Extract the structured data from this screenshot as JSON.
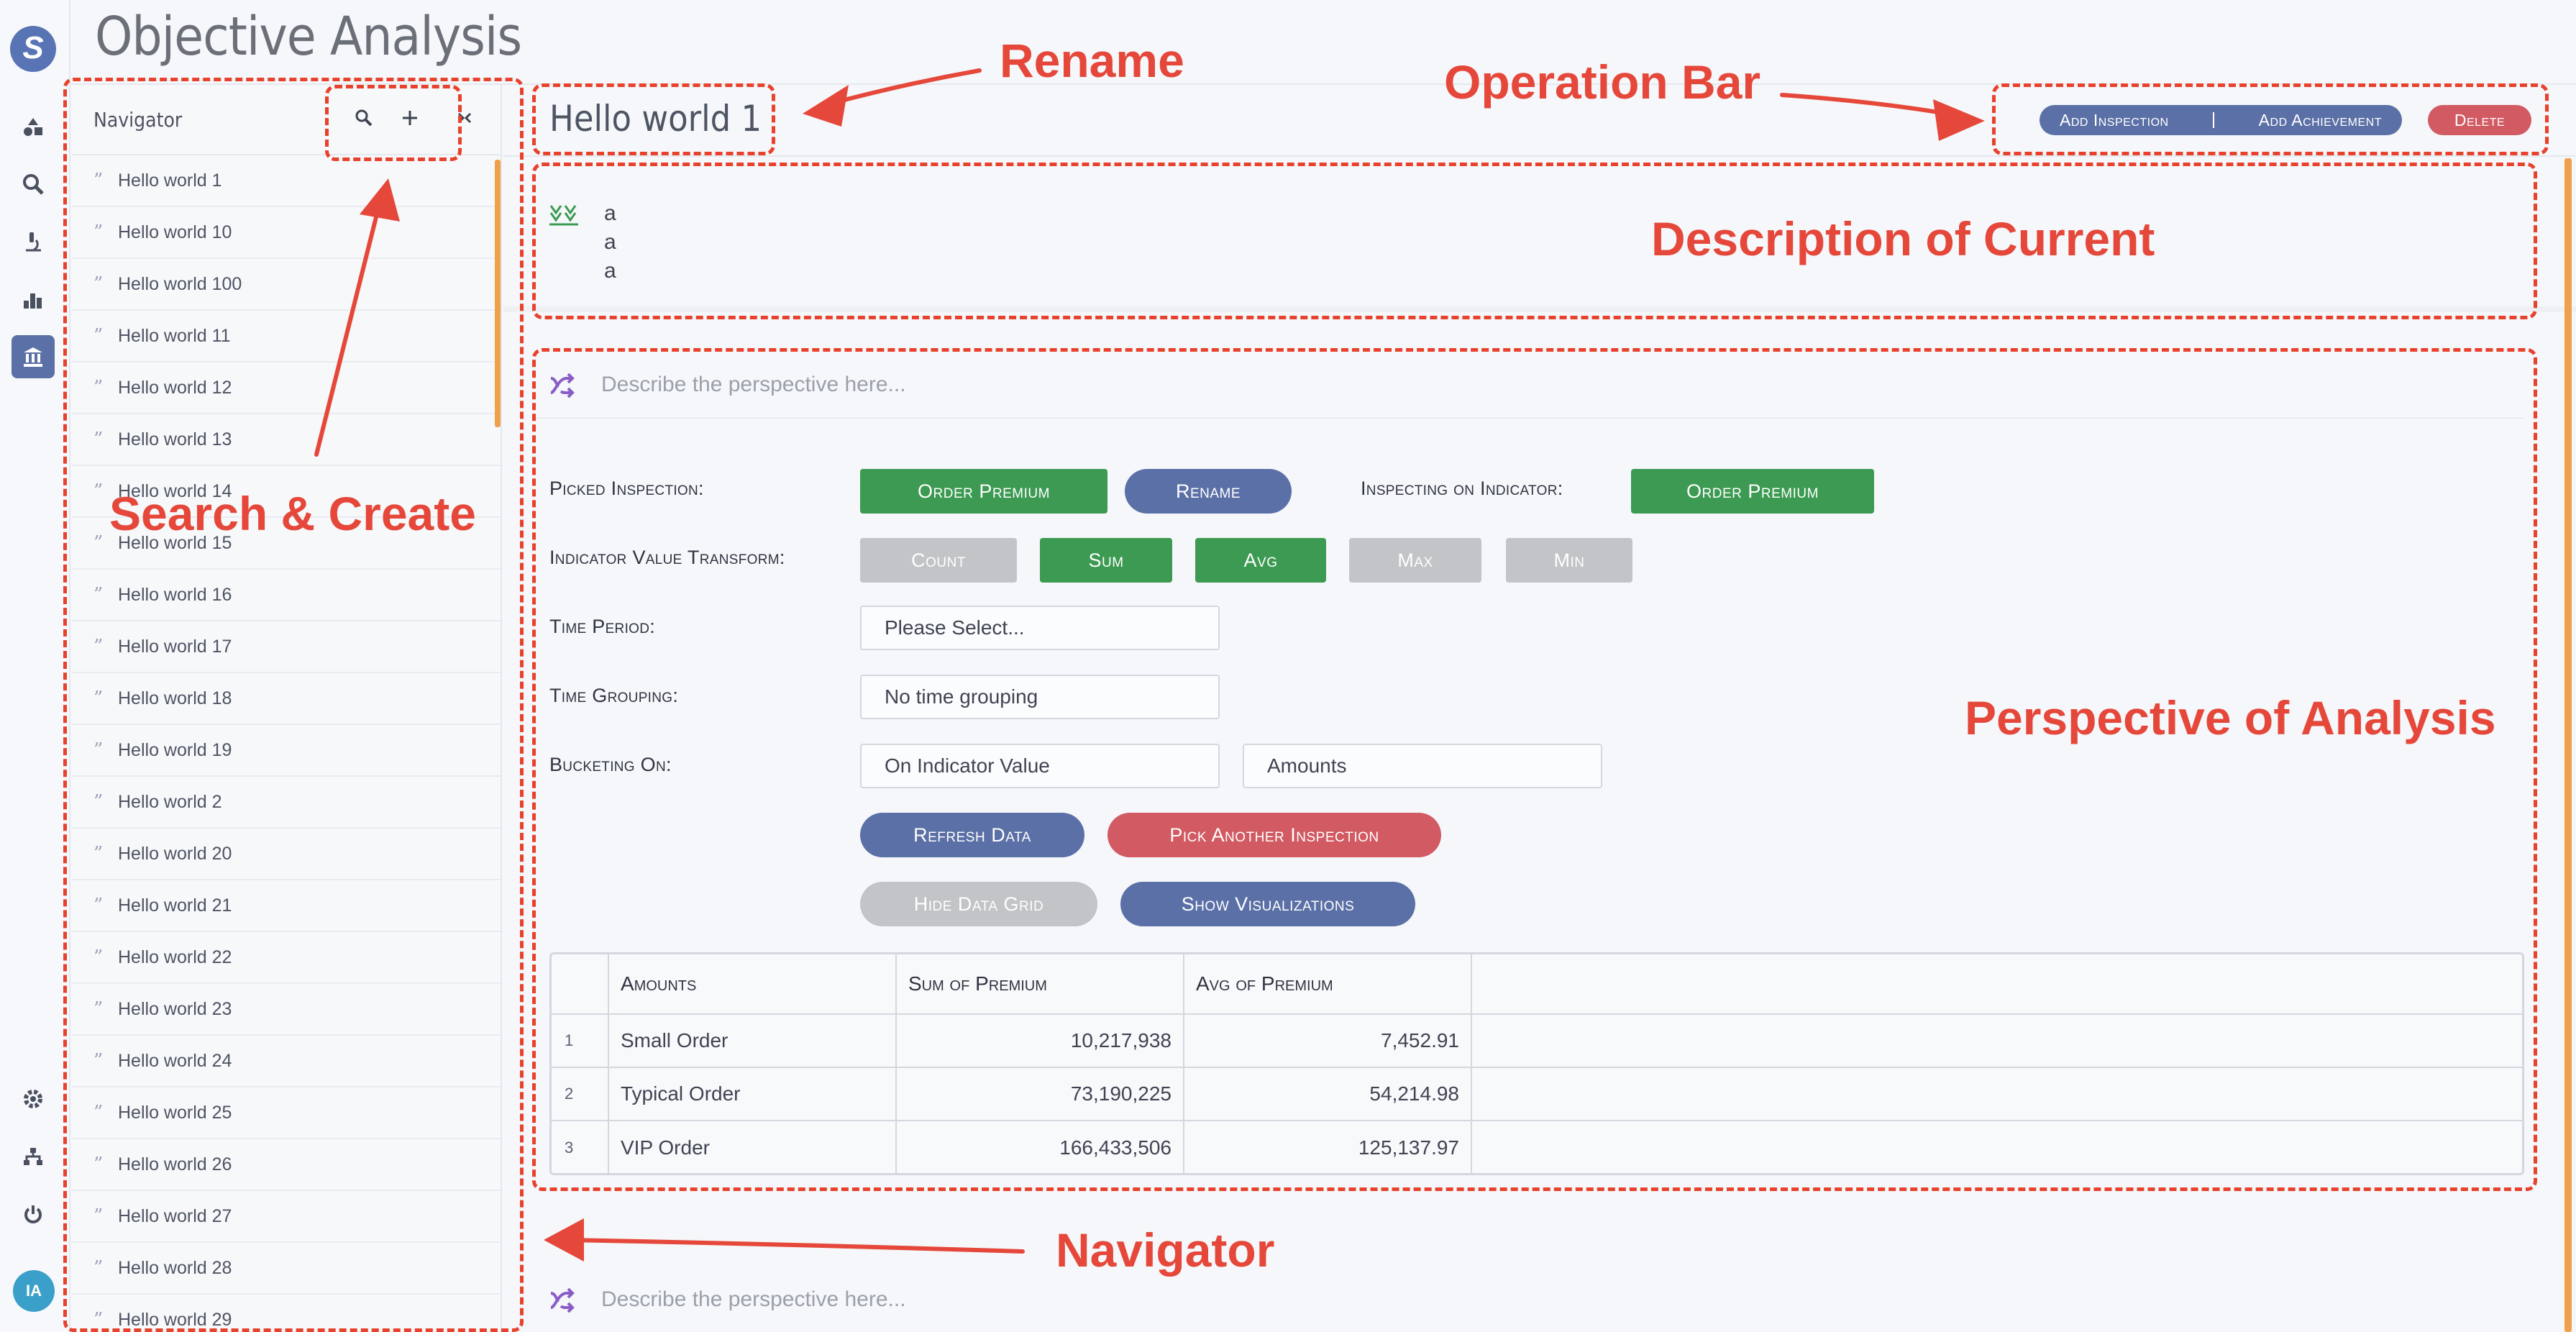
{
  "page": {
    "title": "Objective Analysis"
  },
  "rail": {
    "avatar_initials": "IA"
  },
  "navigator": {
    "title": "Navigator",
    "items": [
      "Hello world 1",
      "Hello world 10",
      "Hello world 100",
      "Hello world 11",
      "Hello world 12",
      "Hello world 13",
      "Hello world 14",
      "Hello world 15",
      "Hello world 16",
      "Hello world 17",
      "Hello world 18",
      "Hello world 19",
      "Hello world 2",
      "Hello world 20",
      "Hello world 21",
      "Hello world 22",
      "Hello world 23",
      "Hello world 24",
      "Hello world 25",
      "Hello world 26",
      "Hello world 27",
      "Hello world 28",
      "Hello world 29"
    ]
  },
  "objective": {
    "name": "Hello world 1",
    "description_lines": [
      "a",
      "a",
      "a"
    ]
  },
  "operation_bar": {
    "add_inspection": "Add Inspection",
    "add_achievement": "Add Achievement",
    "delete": "Delete"
  },
  "perspective": {
    "placeholder": "Describe the perspective here...",
    "picked_inspection_label": "Picked Inspection:",
    "picked_inspection_value": "Order Premium",
    "rename": "Rename",
    "indicator_label": "Inspecting on Indicator:",
    "indicator_value": "Order Premium",
    "transform_label": "Indicator Value Transform:",
    "transforms": [
      {
        "label": "Count",
        "active": false
      },
      {
        "label": "Sum",
        "active": true
      },
      {
        "label": "Avg",
        "active": true
      },
      {
        "label": "Max",
        "active": false
      },
      {
        "label": "Min",
        "active": false
      }
    ],
    "time_period_label": "Time Period:",
    "time_period_value": "Please Select...",
    "time_grouping_label": "Time Grouping:",
    "time_grouping_value": "No time grouping",
    "bucketing_label": "Bucketing On:",
    "bucketing_value": "On Indicator Value",
    "bucketing_bucket": "Amounts",
    "refresh": "Refresh Data",
    "pick_another": "Pick Another Inspection",
    "hide_grid": "Hide Data Grid",
    "show_viz": "Show Visualizations",
    "grid": {
      "headers": [
        "Amounts",
        "Sum of Premium",
        "Avg of Premium"
      ],
      "rows": [
        {
          "index": "1",
          "amounts": "Small Order",
          "sum": "10,217,938",
          "avg": "7,452.91"
        },
        {
          "index": "2",
          "amounts": "Typical Order",
          "sum": "73,190,225",
          "avg": "54,214.98"
        },
        {
          "index": "3",
          "amounts": "VIP Order",
          "sum": "166,433,506",
          "avg": "125,137.97"
        }
      ]
    }
  },
  "perspective2": {
    "placeholder": "Describe the perspective here..."
  },
  "annotations": {
    "rename": "Rename",
    "operation_bar": "Operation Bar",
    "description": "Description of Current",
    "search_create": "Search & Create",
    "perspective": "Perspective of Analysis",
    "navigator": "Navigator"
  },
  "colors": {
    "accent_blue": "#5b70a6",
    "green": "#3c9a52",
    "red": "#d25a63",
    "disabled_grey": "#c2c4c7",
    "annotation_red": "#e5483a",
    "scroll_orange": "#f0a04a"
  }
}
